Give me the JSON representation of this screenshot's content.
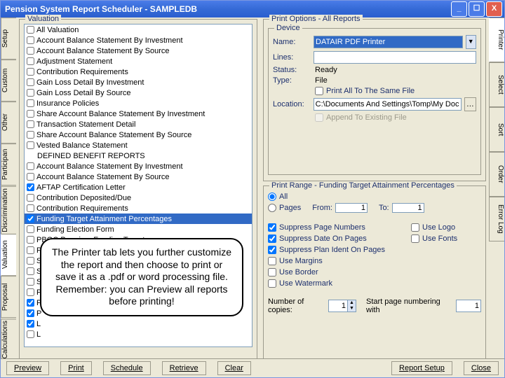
{
  "title": "Pension System Report Scheduler - SAMPLEDB",
  "left_vtabs": [
    "Setup",
    "Custom",
    "Other",
    "Participan",
    "Discrimination",
    "Valuation",
    "Proposal",
    "Calculations"
  ],
  "right_vtabs": [
    "Printer",
    "Select",
    "Sort",
    "Order",
    "Error Log"
  ],
  "valuation_group": "Valuation",
  "list": [
    {
      "t": "All Valuation",
      "c": false,
      "h": false
    },
    {
      "t": "Account Balance Statement By Investment",
      "c": false,
      "h": false
    },
    {
      "t": "Account Balance Statement By Source",
      "c": false,
      "h": false
    },
    {
      "t": "Adjustment Statement",
      "c": false,
      "h": false
    },
    {
      "t": "Contribution Requirements",
      "c": false,
      "h": false
    },
    {
      "t": "Gain Loss Detail By Investment",
      "c": false,
      "h": false
    },
    {
      "t": "Gain Loss Detail By Source",
      "c": false,
      "h": false
    },
    {
      "t": "Insurance Policies",
      "c": false,
      "h": false
    },
    {
      "t": "Share Account Balance Statement By Investment",
      "c": false,
      "h": false
    },
    {
      "t": "Transaction Statement Detail",
      "c": false,
      "h": false
    },
    {
      "t": "Share Account Balance Statement By Source",
      "c": false,
      "h": false
    },
    {
      "t": "Vested Balance Statement",
      "c": false,
      "h": false
    },
    {
      "t": "DEFINED BENEFIT REPORTS",
      "c": null,
      "h": true
    },
    {
      "t": "Account Balance Statement By Investment",
      "c": false,
      "h": false
    },
    {
      "t": "Account Balance Statement By Source",
      "c": false,
      "h": false
    },
    {
      "t": "AFTAP Certification Letter",
      "c": true,
      "h": false
    },
    {
      "t": "Contribution Deposited/Due",
      "c": false,
      "h": false
    },
    {
      "t": "Contribution Requirements",
      "c": false,
      "h": false
    },
    {
      "t": "Funding Target Attainment Percentages",
      "c": true,
      "h": false,
      "sel": true
    },
    {
      "t": "Funding Election Form",
      "c": false,
      "h": false
    },
    {
      "t": "PBGC Premium Funding Target",
      "c": false,
      "h": false
    },
    {
      "t": "Present Value of Accrued Benefits",
      "c": false,
      "h": false
    },
    {
      "t": "Schedule of Post Retirement Participants",
      "c": false,
      "h": false
    },
    {
      "t": "S",
      "c": false,
      "h": false
    },
    {
      "t": "S",
      "c": false,
      "h": false
    },
    {
      "t": "P",
      "c": false,
      "h": false
    },
    {
      "t": "P",
      "c": true,
      "h": false
    },
    {
      "t": "P",
      "c": true,
      "h": false
    },
    {
      "t": "L",
      "c": true,
      "h": false
    },
    {
      "t": "L",
      "c": false,
      "h": false
    }
  ],
  "print_options_title": "Print Options - All Reports",
  "device_title": "Device",
  "device": {
    "name_label": "Name:",
    "name_value": "DATAIR PDF Printer",
    "lines_label": "Lines:",
    "lines_value": "",
    "status_label": "Status:",
    "status_value": "Ready",
    "type_label": "Type:",
    "type_value": "File",
    "chk_same_file": "Print All To The Same File",
    "location_label": "Location:",
    "location_value": "C:\\Documents And Settings\\Tomp\\My Documents\\DAW",
    "chk_append": "Append To Existing File"
  },
  "range_title": "Print Range - Funding Target Attainment Percentages",
  "range": {
    "all": "All",
    "pages": "Pages",
    "from": "From:",
    "from_v": "1",
    "to": "To:",
    "to_v": "1",
    "opts1": [
      {
        "l": "Suppress Page Numbers",
        "c": true
      },
      {
        "l": "Suppress Date On Pages",
        "c": true
      },
      {
        "l": "Suppress Plan Ident On Pages",
        "c": true
      },
      {
        "l": "Use Margins",
        "c": false
      },
      {
        "l": "Use Border",
        "c": false
      },
      {
        "l": "Use Watermark",
        "c": false
      }
    ],
    "opts2": [
      {
        "l": "Use Logo",
        "c": false
      },
      {
        "l": "Use Fonts",
        "c": false
      }
    ],
    "copies_label": "Number of copies:",
    "copies_v": "1",
    "startpg_label": "Start page numbering with",
    "startpg_v": "1"
  },
  "footer": [
    "Preview",
    "Print",
    "Schedule",
    "Retrieve",
    "Clear",
    "Report Setup",
    "Close"
  ],
  "callout": "The Printer tab lets you further customize the report and then choose to print or save it as a .pdf or word processing file.\nRemember: you can Preview all reports before printing!"
}
